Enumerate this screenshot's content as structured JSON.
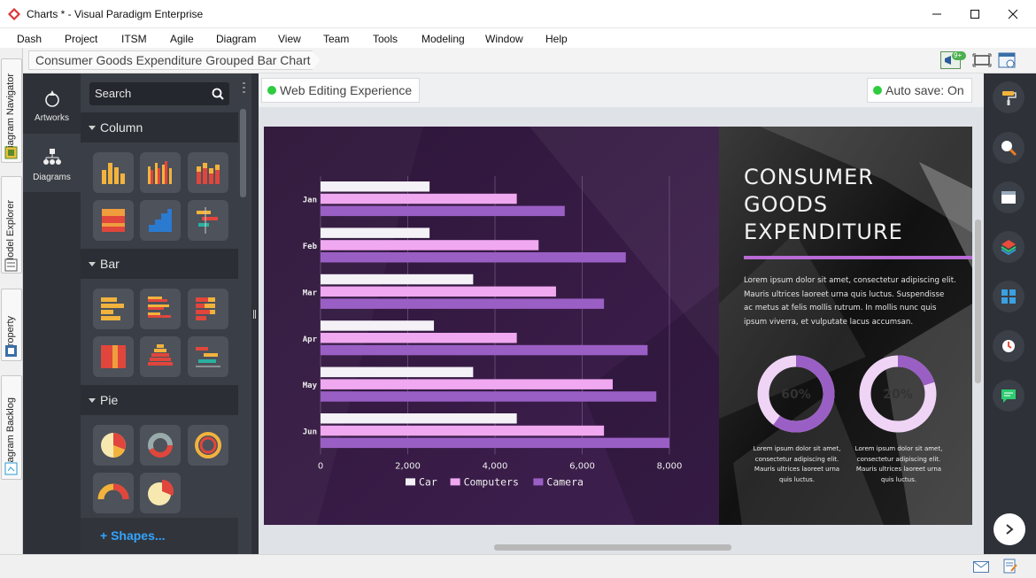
{
  "window": {
    "title": "Charts * - Visual Paradigm Enterprise"
  },
  "menu": [
    "Dash",
    "Project",
    "ITSM",
    "Agile",
    "Diagram",
    "View",
    "Team",
    "Tools",
    "Modeling",
    "Window",
    "Help"
  ],
  "breadcrumb": "Consumer Goods Expenditure Grouped Bar Chart",
  "notification_badge": "9+",
  "left_tabs": [
    "Diagram Navigator",
    "Model Explorer",
    "Property",
    "Diagram Backlog"
  ],
  "art_nav": [
    {
      "label": "Artworks",
      "icon": "artworks-icon"
    },
    {
      "label": "Diagrams",
      "icon": "diagrams-icon"
    }
  ],
  "shape_panel": {
    "search_placeholder": "Search",
    "sections": [
      "Column",
      "Bar",
      "Pie"
    ],
    "shapes_link": "+ Shapes..."
  },
  "canvas": {
    "web_editing": "Web Editing Experience",
    "auto_save": "Auto save: On"
  },
  "poster": {
    "headline": [
      "CONSUMER",
      "GOODS",
      "EXPENDITURE"
    ],
    "body": [
      "Lorem ipsum dolor sit amet, consectetur adipiscing elit.",
      "Mauris ultrices laoreet urna quis luctus. Suspendisse",
      "ac metus at felis mollis rutrum. In mollis nunc quis",
      "ipsum viverra, et vulputate lacus accumsan."
    ],
    "donuts": [
      {
        "label": "60%",
        "value": 60,
        "caption": [
          "Lorem ipsum dolor sit amet,",
          "consectetur adipiscing elit.",
          "Mauris ultrices laoreet urna",
          "quis luctus."
        ]
      },
      {
        "label": "20%",
        "value": 20,
        "caption": [
          "Lorem ipsum dolor sit amet,",
          "consectetur adipiscing elit.",
          "Mauris ultrices laoreet urna",
          "quis luctus."
        ]
      }
    ],
    "colors": {
      "car": "#f4f1f7",
      "computers": "#f0a8f0",
      "camera": "#9a5fc4",
      "dark": "#3e1f4d",
      "accent": "#b86ad6"
    }
  },
  "chart_data": {
    "type": "bar",
    "orientation": "horizontal",
    "categories": [
      "Jan",
      "Feb",
      "Mar",
      "Apr",
      "May",
      "Jun"
    ],
    "series": [
      {
        "name": "Car",
        "values": [
          2500,
          2500,
          3500,
          2600,
          3500,
          4500
        ]
      },
      {
        "name": "Computers",
        "values": [
          4500,
          5000,
          5400,
          4500,
          6700,
          6500
        ]
      },
      {
        "name": "Camera",
        "values": [
          5600,
          7000,
          6500,
          7500,
          7700,
          8000
        ]
      }
    ],
    "xlim": [
      0,
      8000
    ],
    "xticks": [
      "0",
      "2,000",
      "4,000",
      "6,000",
      "8,000"
    ],
    "legend": "bottom",
    "grid": true
  }
}
